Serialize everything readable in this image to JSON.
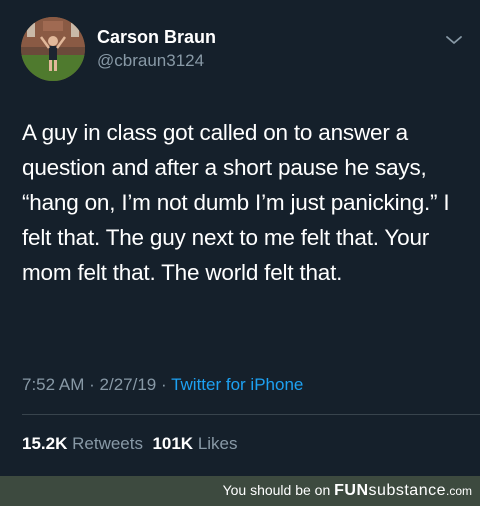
{
  "tweet": {
    "display_name": "Carson Braun",
    "handle": "@cbraun3124",
    "text": "A guy in class got called on to answer a question and after a short pause he says, “hang on, I’m not dumb I’m just panicking.” I felt that. The guy next to me felt that. Your mom felt that. The world felt that.",
    "time": "7:52 AM",
    "date": "2/27/19",
    "sep": "·",
    "source": "Twitter for iPhone",
    "retweets_count": "15.2K",
    "retweets_label": "Retweets",
    "likes_count": "101K",
    "likes_label": "Likes",
    "menu_icon": "chevron-down-icon",
    "colors": {
      "background": "#15202b",
      "secondary_text": "#8899a6",
      "link": "#1da1f2",
      "footer_bg": "#3d4a3f"
    }
  },
  "footer": {
    "prefix": "You should be on ",
    "brand_fun": "FUN",
    "brand_substance": "substance",
    "brand_tld": ".com"
  }
}
